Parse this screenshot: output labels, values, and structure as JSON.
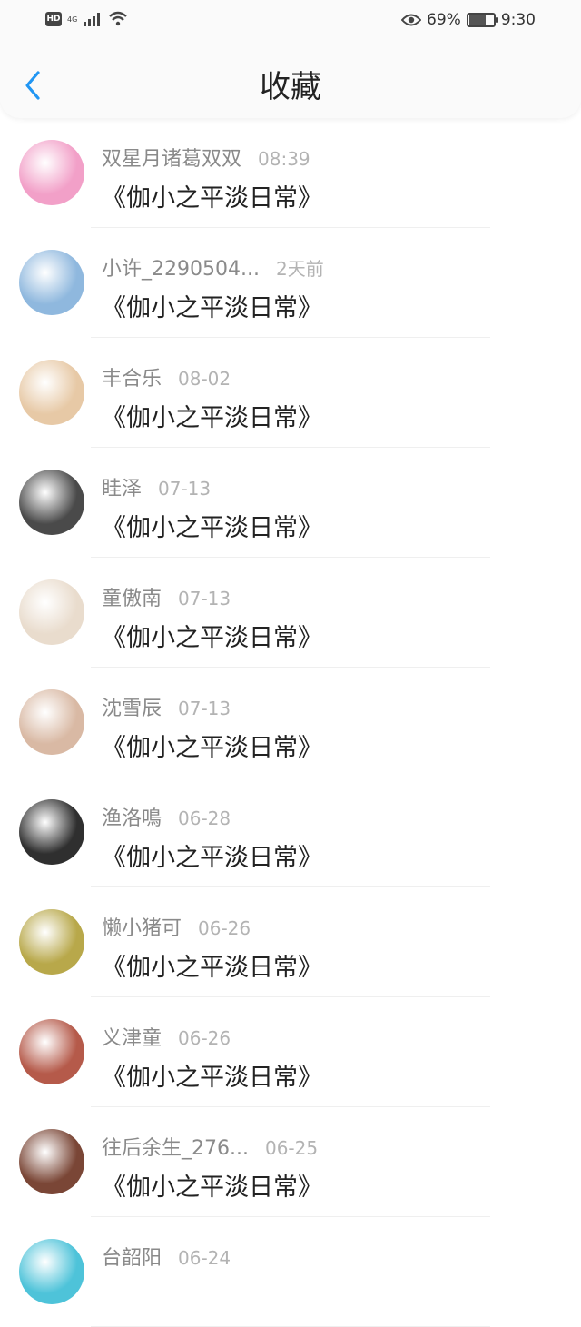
{
  "status_bar": {
    "hd": "HD",
    "net": "4G",
    "battery_percent": "69%",
    "battery_level": 0.69,
    "time": "9:30",
    "icons": [
      "signal-icon",
      "wifi-icon",
      "eye-icon",
      "battery-icon"
    ]
  },
  "header": {
    "title": "收藏",
    "back_icon": "chevron-left-icon",
    "accent_color": "#2196f3"
  },
  "items": [
    {
      "name": "双星月诸葛双双",
      "time": "08:39",
      "title": "《伽小之平淡日常》",
      "avatar_color": "#f2a0c8"
    },
    {
      "name": "小许_2290504...",
      "time": "2天前",
      "title": "《伽小之平淡日常》",
      "avatar_color": "#8fb8de"
    },
    {
      "name": "丰合乐",
      "time": "08-02",
      "title": "《伽小之平淡日常》",
      "avatar_color": "#e7c9a6"
    },
    {
      "name": "眭泽",
      "time": "07-13",
      "title": "《伽小之平淡日常》",
      "avatar_color": "#4a4a4a"
    },
    {
      "name": "童傲南",
      "time": "07-13",
      "title": "《伽小之平淡日常》",
      "avatar_color": "#e9dccd"
    },
    {
      "name": "沈雪辰",
      "time": "07-13",
      "title": "《伽小之平淡日常》",
      "avatar_color": "#d9b9a4"
    },
    {
      "name": "渔洛鳴",
      "time": "06-28",
      "title": "《伽小之平淡日常》",
      "avatar_color": "#2f2f2f"
    },
    {
      "name": "懒小猪可",
      "time": "06-26",
      "title": "《伽小之平淡日常》",
      "avatar_color": "#b8a84a"
    },
    {
      "name": "义津童",
      "time": "06-26",
      "title": "《伽小之平淡日常》",
      "avatar_color": "#b55a4a"
    },
    {
      "name": "往后余生_276...",
      "time": "06-25",
      "title": "《伽小之平淡日常》",
      "avatar_color": "#7a4636"
    },
    {
      "name": "台韶阳",
      "time": "06-24",
      "title": "",
      "avatar_color": "#4ec3d9"
    }
  ]
}
